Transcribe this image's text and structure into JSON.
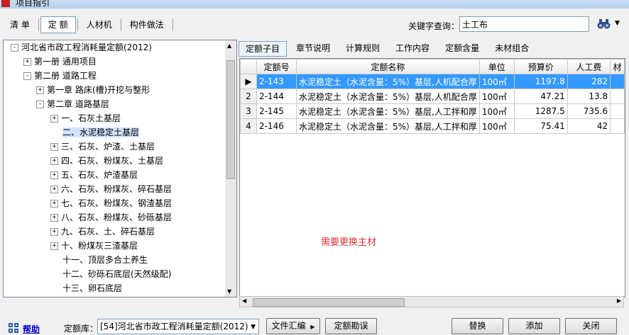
{
  "window": {
    "title": "项目指引"
  },
  "top_tabs": [
    {
      "label": "清 单",
      "selected": false
    },
    {
      "label": "定 额",
      "selected": true
    },
    {
      "label": "人材机",
      "selected": false
    },
    {
      "label": "构件做法",
      "selected": false
    }
  ],
  "search": {
    "label": "关键字查询：",
    "value": "土工布"
  },
  "tree": [
    {
      "label": "河北省市政工程消耗量定额(2012)",
      "exp": "-",
      "selected": false
    },
    {
      "label": "第一册 通用项目",
      "exp": "+",
      "selected": false
    },
    {
      "label": "第二册 道路工程",
      "exp": "-",
      "selected": false
    },
    {
      "label": "第一章 路床(槽)开挖与整形",
      "exp": "+",
      "selected": false
    },
    {
      "label": "第二章 道路基层",
      "exp": "-",
      "selected": false
    },
    {
      "label": "一、石灰土基层",
      "exp": "+",
      "selected": false
    },
    {
      "label": "二、水泥稳定土基层",
      "exp": "",
      "selected": true
    },
    {
      "label": "三、石灰、炉渣、土基层",
      "exp": "+",
      "selected": false
    },
    {
      "label": "四、石灰、粉煤灰、土基层",
      "exp": "+",
      "selected": false
    },
    {
      "label": "五、石灰、炉渣基层",
      "exp": "+",
      "selected": false
    },
    {
      "label": "六、石灰、粉煤灰、碎石基层",
      "exp": "+",
      "selected": false
    },
    {
      "label": "七、石灰、粉煤灰、钢渣基层",
      "exp": "+",
      "selected": false
    },
    {
      "label": "八、石灰、粉煤灰、砂砾基层",
      "exp": "+",
      "selected": false
    },
    {
      "label": "九、石灰、土、碎石基层",
      "exp": "+",
      "selected": false
    },
    {
      "label": "十、粉煤灰三渣基层",
      "exp": "+",
      "selected": false
    },
    {
      "label": "十一、顶层多合土养生",
      "exp": "",
      "selected": false
    },
    {
      "label": "十二、砂砾石底层(天然级配)",
      "exp": "",
      "selected": false
    },
    {
      "label": "十三、卵石底层",
      "exp": "",
      "selected": false
    }
  ],
  "right_tabs": [
    {
      "label": "定额子目",
      "selected": true
    },
    {
      "label": "章节说明",
      "selected": false
    },
    {
      "label": "计算规则",
      "selected": false
    },
    {
      "label": "工作内容",
      "selected": false
    },
    {
      "label": "定额含量",
      "selected": false
    },
    {
      "label": "未材组合",
      "selected": false
    }
  ],
  "table": {
    "headers": [
      "定额号",
      "定额名称",
      "单位",
      "预算价",
      "人工费",
      "材"
    ],
    "rows": [
      {
        "idx": "1",
        "code": "2-143",
        "name": "水泥稳定土（水泥含量：5%）基层,人机配合厚",
        "unit": "100㎡",
        "price": "1197.8",
        "labor": "282",
        "selected": true
      },
      {
        "idx": "2",
        "code": "2-144",
        "name": "水泥稳定土（水泥含量：5%）基层,人机配合厚",
        "unit": "100㎡",
        "price": "47.21",
        "labor": "13.8",
        "selected": false
      },
      {
        "idx": "3",
        "code": "2-145",
        "name": "水泥稳定土（水泥含量：5%）基层,人工拌和厚",
        "unit": "100㎡",
        "price": "1287.5",
        "labor": "735.6",
        "selected": false
      },
      {
        "idx": "4",
        "code": "2-146",
        "name": "水泥稳定土（水泥含量：5%）基层,人工拌和厚",
        "unit": "100㎡",
        "price": "75.41",
        "labor": "42",
        "selected": false
      }
    ]
  },
  "note": "需要更换主材",
  "bottom": {
    "help": "帮助",
    "lib_label": "定额库：",
    "lib_value": "[54]河北省市政工程消耗量定额(2012)",
    "btn_summary": "文件汇编",
    "btn_errata": "定额勘误",
    "btn_replace": "替换",
    "btn_add": "添加",
    "btn_close": "关闭"
  }
}
